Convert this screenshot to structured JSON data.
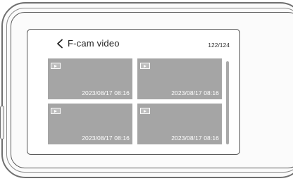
{
  "header": {
    "title": "F-cam video",
    "counter": "122/124"
  },
  "videos": [
    {
      "timestamp": "2023/08/17 08:16",
      "icon": "play-badge-icon"
    },
    {
      "timestamp": "2023/08/17 08:16",
      "icon": "play-badge-icon"
    },
    {
      "timestamp": "2023/08/17 08:16",
      "icon": "play-badge-icon"
    },
    {
      "timestamp": "2023/08/17 08:16",
      "icon": "play-badge-icon"
    }
  ],
  "colors": {
    "tile": "#a5a5a5",
    "text": "#222222",
    "scrollbar": "#a9a9a9"
  },
  "icons": {
    "back": "chevron-left-icon"
  }
}
